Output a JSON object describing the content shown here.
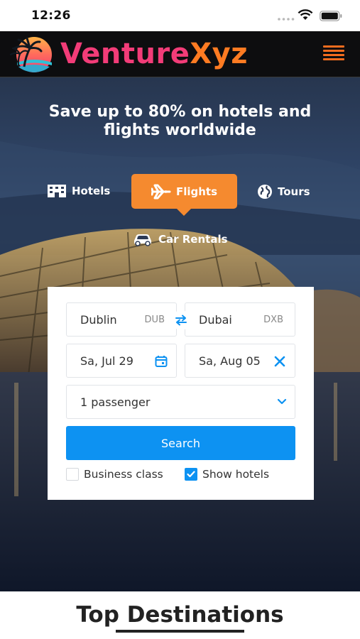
{
  "status_bar": {
    "time": "12:26"
  },
  "header": {
    "brand_part1": "Venture",
    "brand_part2": "Xyz",
    "logo_icon": "palm-beach-sunset-logo",
    "menu_icon": "hamburger-menu-icon"
  },
  "hero": {
    "headline": "Save up to 80% on hotels and flights worldwide",
    "tabs": [
      {
        "label": "Hotels",
        "icon": "hotel-icon",
        "selected": false
      },
      {
        "label": "Flights",
        "icon": "airplane-icon",
        "selected": true
      },
      {
        "label": "Tours",
        "icon": "globe-icon",
        "selected": false
      },
      {
        "label": "Car Rentals",
        "icon": "car-icon",
        "selected": false
      }
    ]
  },
  "search": {
    "origin": {
      "city": "Dublin",
      "code": "DUB"
    },
    "destination": {
      "city": "Dubai",
      "code": "DXB"
    },
    "depart_date": "Sa, Jul 29",
    "return_date": "Sa, Aug 05",
    "passengers": "1 passenger",
    "search_label": "Search",
    "business_class": {
      "label": "Business class",
      "checked": false
    },
    "show_hotels": {
      "label": "Show hotels",
      "checked": true
    }
  },
  "destinations": {
    "title": "Top Destinations"
  },
  "colors": {
    "brand_pink": "#f23c78",
    "brand_orange": "#ff7b22",
    "tab_active": "#f58a2f",
    "primary_blue": "#0d92f2"
  }
}
